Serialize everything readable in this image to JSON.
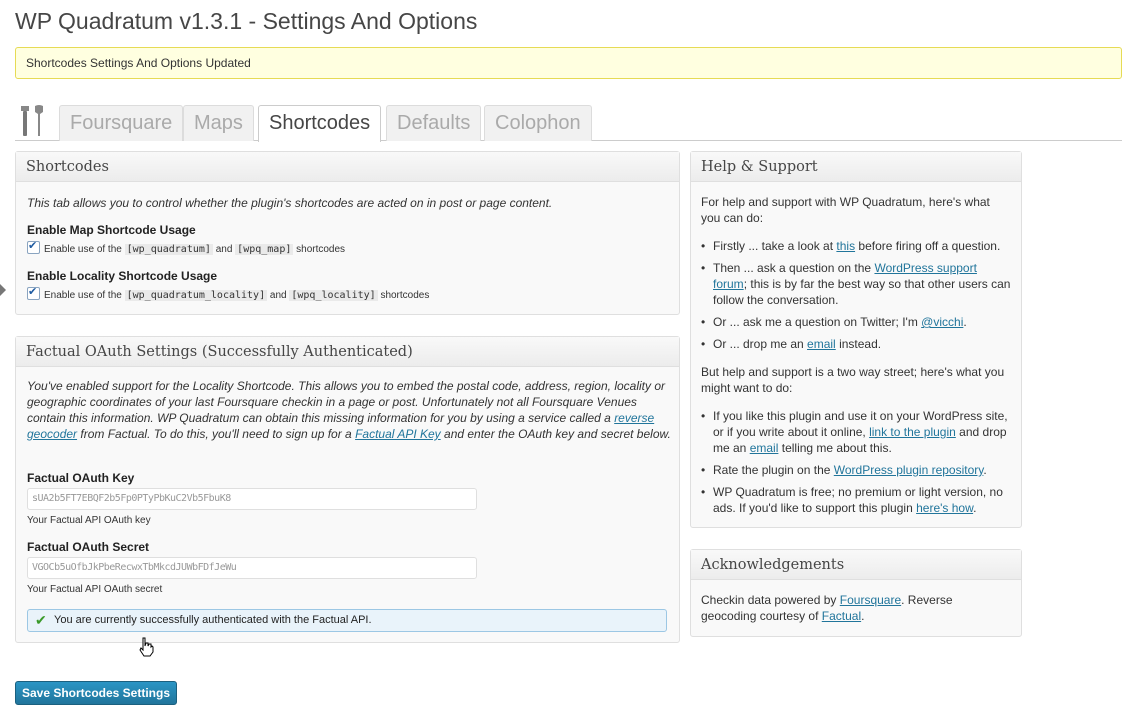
{
  "page": {
    "title": "WP Quadratum v1.3.1 - Settings And Options"
  },
  "notice": {
    "text": "Shortcodes Settings And Options Updated"
  },
  "tabs": [
    {
      "label": "Foursquare",
      "active": false
    },
    {
      "label": "Maps",
      "active": false
    },
    {
      "label": "Shortcodes",
      "active": true
    },
    {
      "label": "Defaults",
      "active": false
    },
    {
      "label": "Colophon",
      "active": false
    }
  ],
  "shortcodes_box": {
    "title": "Shortcodes",
    "intro": "This tab allows you to control whether the plugin's shortcodes are acted on in post or page content.",
    "map": {
      "heading": "Enable Map Shortcode Usage",
      "pre": "Enable use of the",
      "code1": "[wp_quadratum]",
      "mid": "and",
      "code2": "[wpq_map]",
      "post": "shortcodes",
      "checked": true
    },
    "locality": {
      "heading": "Enable Locality Shortcode Usage",
      "pre": "Enable use of the",
      "code1": "[wp_quadratum_locality]",
      "mid": "and",
      "code2": "[wpq_locality]",
      "post": "shortcodes",
      "checked": true
    }
  },
  "factual_box": {
    "title": "Factual OAuth Settings (Successfully Authenticated)",
    "intro_1": "You've enabled support for the Locality Shortcode. This allows you to embed the postal code, address, region, locality or geographic coordinates of your last Foursquare checkin in a page or post. Unfortunately not all Foursquare Venues contain this information. WP Quadratum can obtain this missing information for you by using a service called a",
    "link_reverse_geocoder": "reverse geocoder",
    "intro_2": "from Factual. To do this, you'll need to sign up for a",
    "link_api_key": "Factual API Key",
    "intro_3": "and enter the OAuth key and secret below.",
    "key_label": "Factual OAuth Key",
    "key_value": "sUA2b5FT7EBQF2b5Fp0PTyPbKuC2Vb5FbuK8",
    "key_help": "Your Factual API OAuth key",
    "secret_label": "Factual OAuth Secret",
    "secret_value": "VGOCb5uOfbJkPbeRecwxTbMkcdJUWbFDfJeWu",
    "secret_help": "Your Factual API OAuth secret",
    "success": "You are currently successfully authenticated with the Factual API."
  },
  "help_box": {
    "title": "Help & Support",
    "intro": "For help and support with WP Quadratum, here's what you can do:",
    "items": [
      {
        "pre": "Firstly ... take a look at",
        "link": "this",
        "post": "before firing off a question."
      },
      {
        "pre": "Then ... ask a question on the",
        "link": "WordPress support forum",
        "post": "; this is by far the best way so that other users can follow the conversation."
      },
      {
        "pre": "Or ... ask me a question on Twitter; I'm",
        "link": "@vicchi",
        "post": "."
      },
      {
        "pre": "Or ... drop me an",
        "link": "email",
        "post": "instead."
      }
    ],
    "intro2": "But help and support is a two way street; here's what you might want to do:",
    "items2": [
      {
        "pre": "If you like this plugin and use it on your WordPress site, or if you write about it online,",
        "link": "link to the plugin",
        "mid": "and drop me an",
        "link2": "email",
        "post": "telling me about this."
      },
      {
        "pre": "Rate the plugin on the",
        "link": "WordPress plugin repository",
        "post": "."
      },
      {
        "pre": "WP Quadratum is free; no premium or light version, no ads. If you'd like to support this plugin",
        "link": "here's how",
        "post": "."
      }
    ]
  },
  "ack_box": {
    "title": "Acknowledgements",
    "pre": "Checkin data powered by",
    "link1": "Foursquare",
    "mid": ". Reverse geocoding courtesy of",
    "link2": "Factual",
    "post": "."
  },
  "save_button": {
    "label": "Save Shortcodes Settings"
  },
  "colors": {
    "accent": "#21759b",
    "notice_bg": "#ffffe0",
    "success_bg": "#e9f3fa"
  },
  "icons": {
    "tab_icon": "tools-icon",
    "success_icon": "checkmark-icon"
  }
}
